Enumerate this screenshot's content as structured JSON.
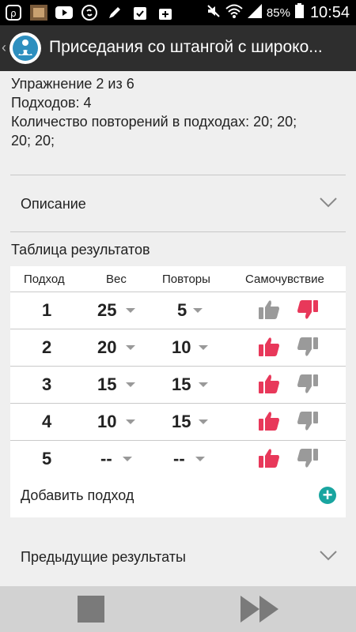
{
  "status_bar": {
    "battery": "85%",
    "time": "10:54",
    "icons": [
      "r-app-icon",
      "game-icon",
      "youtube-icon",
      "shazam-icon",
      "pen-icon",
      "clipboard-check-icon",
      "bag-plus-icon",
      "mute-icon",
      "wifi-icon",
      "signal-icon",
      "battery-icon"
    ]
  },
  "app_bar": {
    "title": "Приседания со штангой с широко..."
  },
  "info": {
    "exercise": "Упражнение 2 из 6",
    "sets": "Подходов: 4",
    "reps_line1": "Количество повторений в подходах: 20; 20;",
    "reps_line2": "20; 20;"
  },
  "description": {
    "label": "Описание"
  },
  "results": {
    "title": "Таблица результатов",
    "headers": {
      "set": "Подход",
      "weight": "Вес",
      "reps": "Повторы",
      "feeling": "Самочувствие"
    },
    "rows": [
      {
        "set": "1",
        "weight": "25",
        "reps": "5",
        "feeling": "bad"
      },
      {
        "set": "2",
        "weight": "20",
        "reps": "10",
        "feeling": "good"
      },
      {
        "set": "3",
        "weight": "15",
        "reps": "15",
        "feeling": "good"
      },
      {
        "set": "4",
        "weight": "10",
        "reps": "15",
        "feeling": "good"
      },
      {
        "set": "5",
        "weight": "--",
        "reps": "--",
        "feeling": "good"
      }
    ],
    "add_label": "Добавить подход"
  },
  "previous": {
    "label": "Предыдущие результаты"
  },
  "colors": {
    "accent": "#e8385a",
    "inactive": "#9a9a9a",
    "teal": "#19a5a0"
  }
}
